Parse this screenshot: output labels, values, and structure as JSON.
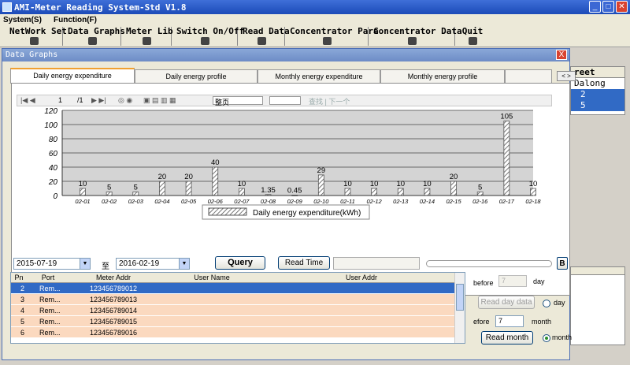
{
  "window": {
    "title": "AMI-Meter Reading System-Std V1.8"
  },
  "menu": [
    "System(S)",
    "Function(F)"
  ],
  "toolbar": [
    {
      "label": "NetWork Set",
      "icon": "network-icon"
    },
    {
      "label": "Data Graphs",
      "icon": "chart-icon"
    },
    {
      "label": "Meter Lib",
      "icon": "meter-icon"
    },
    {
      "label": "Switch On/Off",
      "icon": "switch-icon"
    },
    {
      "label": "Read Data",
      "icon": "read-icon"
    },
    {
      "label": "Concentrator Para",
      "icon": "concentrator-icon"
    },
    {
      "label": "Concentrator Data",
      "icon": "database-icon"
    },
    {
      "label": "Quit",
      "icon": "exit-icon"
    }
  ],
  "background_grid": {
    "header": "reet",
    "rows": [
      "Dalong",
      "2",
      "5"
    ]
  },
  "dialog": {
    "title": "Data Graphs",
    "close": "X",
    "tabs": [
      "Daily energy expenditure",
      "Daily energy profile",
      "Monthly energy expenditure",
      "Monthly energy profile"
    ],
    "tab_scroll": "< >",
    "report_toolbar": {
      "page": "1",
      "pages": "/1",
      "zoom": "整页",
      "find": "查找 | 下一个"
    },
    "start_date": "2015-07-19",
    "to_label": "至",
    "end_date": "2016-02-19",
    "query_button": "Query",
    "read_time_button": "Read Time",
    "b_label": "B",
    "table": {
      "columns": [
        "Pn",
        "Port",
        "Meter Addr",
        "User Name",
        "User Addr"
      ],
      "rows": [
        {
          "pn": "2",
          "port": "Rem...",
          "addr": "123456789012",
          "selected": true
        },
        {
          "pn": "3",
          "port": "Rem...",
          "addr": "123456789013"
        },
        {
          "pn": "4",
          "port": "Rem...",
          "addr": "123456789014"
        },
        {
          "pn": "5",
          "port": "Rem...",
          "addr": "123456789015"
        },
        {
          "pn": "6",
          "port": "Rem...",
          "addr": "123456789016"
        }
      ]
    },
    "side": {
      "before_label": "before",
      "day_value": "7",
      "day_label": "day",
      "read_day_button": "Read day data",
      "day_radio_label": "day",
      "fefore_label": "efore",
      "month_value": "7",
      "month_label": "month",
      "read_month_button": "Read month",
      "month_radio_label": "month",
      "selected_radio": "month"
    }
  },
  "chart_data": {
    "type": "bar",
    "categories": [
      "02-01",
      "02-02",
      "02-03",
      "02-04",
      "02-05",
      "02-06",
      "02-07",
      "02-08",
      "02-09",
      "02-10",
      "02-11",
      "02-12",
      "02-13",
      "02-14",
      "02-15",
      "02-16",
      "02-17",
      "02-18"
    ],
    "values": [
      10,
      5,
      5,
      20,
      20,
      40,
      10,
      1.35,
      0.45,
      29,
      10,
      10,
      10,
      10,
      20,
      5,
      105,
      10
    ],
    "value_labels": [
      "10",
      "5",
      "5",
      "20",
      "20",
      "40",
      "10",
      "1.35",
      "0.45",
      "29",
      "10",
      "10",
      "10",
      "10",
      "20",
      "5",
      "105",
      "10"
    ],
    "yticks": [
      "0",
      "20",
      "40",
      "60",
      "80",
      "100",
      "120"
    ],
    "ylim": [
      0,
      120
    ],
    "legend": "Daily energy expenditure(kWh)",
    "grid": true,
    "legend_position": "bottom"
  }
}
